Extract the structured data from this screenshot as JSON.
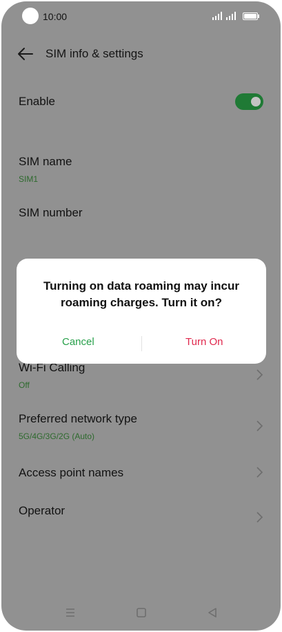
{
  "status_bar": {
    "time": "10:00"
  },
  "header": {
    "title": "SIM info & settings"
  },
  "settings": {
    "enable_label": "Enable",
    "enable_state": "on",
    "sim_name_label": "SIM name",
    "sim_name_value": "SIM1",
    "sim_number_label": "SIM number",
    "wifi_calling_label": "Wi-Fi Calling",
    "wifi_calling_value": "Off",
    "network_type_label": "Preferred network type",
    "network_type_value": "5G/4G/3G/2G (Auto)",
    "apn_label": "Access point names",
    "operator_label": "Operator"
  },
  "dialog": {
    "message": "Turning on data roaming may incur roaming charges. Turn it on?",
    "cancel_label": "Cancel",
    "confirm_label": "Turn On"
  },
  "nav": {
    "icons": [
      "menu-icon",
      "home-icon",
      "back-icon"
    ]
  },
  "colors": {
    "accent_green": "#1f7a35",
    "cancel_color": "#27a04a",
    "confirm_color": "#e0284d",
    "scrim_background": "#919191"
  }
}
